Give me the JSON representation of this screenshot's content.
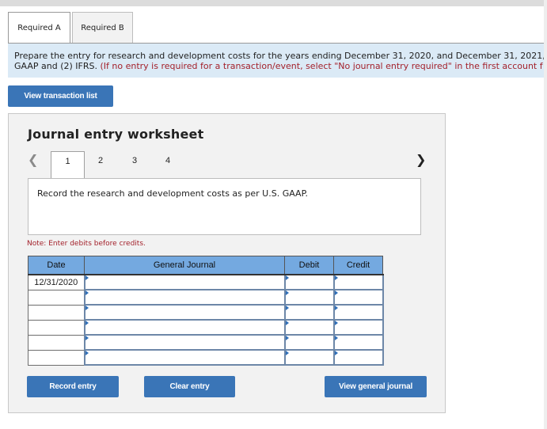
{
  "tabs": [
    {
      "label": "Required A",
      "active": true
    },
    {
      "label": "Required B",
      "active": false
    }
  ],
  "instructions": {
    "line1": "Prepare the entry for research and development costs for the years ending December 31, 2020, and December 31, 2021,",
    "line2_black": "GAAP and (2) IFRS. ",
    "line2_red": "(If no entry is required for a transaction/event, select \"No journal entry required\" in the first account f"
  },
  "buttons": {
    "view_transaction_list": "View transaction list",
    "record_entry": "Record entry",
    "clear_entry": "Clear entry",
    "view_general_journal": "View general journal"
  },
  "worksheet": {
    "title": "Journal entry worksheet",
    "prev_icon": "chevron-left-icon",
    "next_icon": "chevron-right-icon",
    "steps": [
      "1",
      "2",
      "3",
      "4"
    ],
    "active_step": "1",
    "description": "Record the research and development costs as per U.S. GAAP.",
    "note": "Note: Enter debits before credits.",
    "table": {
      "headers": {
        "date": "Date",
        "journal": "General Journal",
        "debit": "Debit",
        "credit": "Credit"
      },
      "rows": [
        {
          "date": "12/31/2020",
          "account": "",
          "debit": "",
          "credit": ""
        },
        {
          "date": "",
          "account": "",
          "debit": "",
          "credit": ""
        },
        {
          "date": "",
          "account": "",
          "debit": "",
          "credit": ""
        },
        {
          "date": "",
          "account": "",
          "debit": "",
          "credit": ""
        },
        {
          "date": "",
          "account": "",
          "debit": "",
          "credit": ""
        },
        {
          "date": "",
          "account": "",
          "debit": "",
          "credit": ""
        }
      ]
    }
  }
}
